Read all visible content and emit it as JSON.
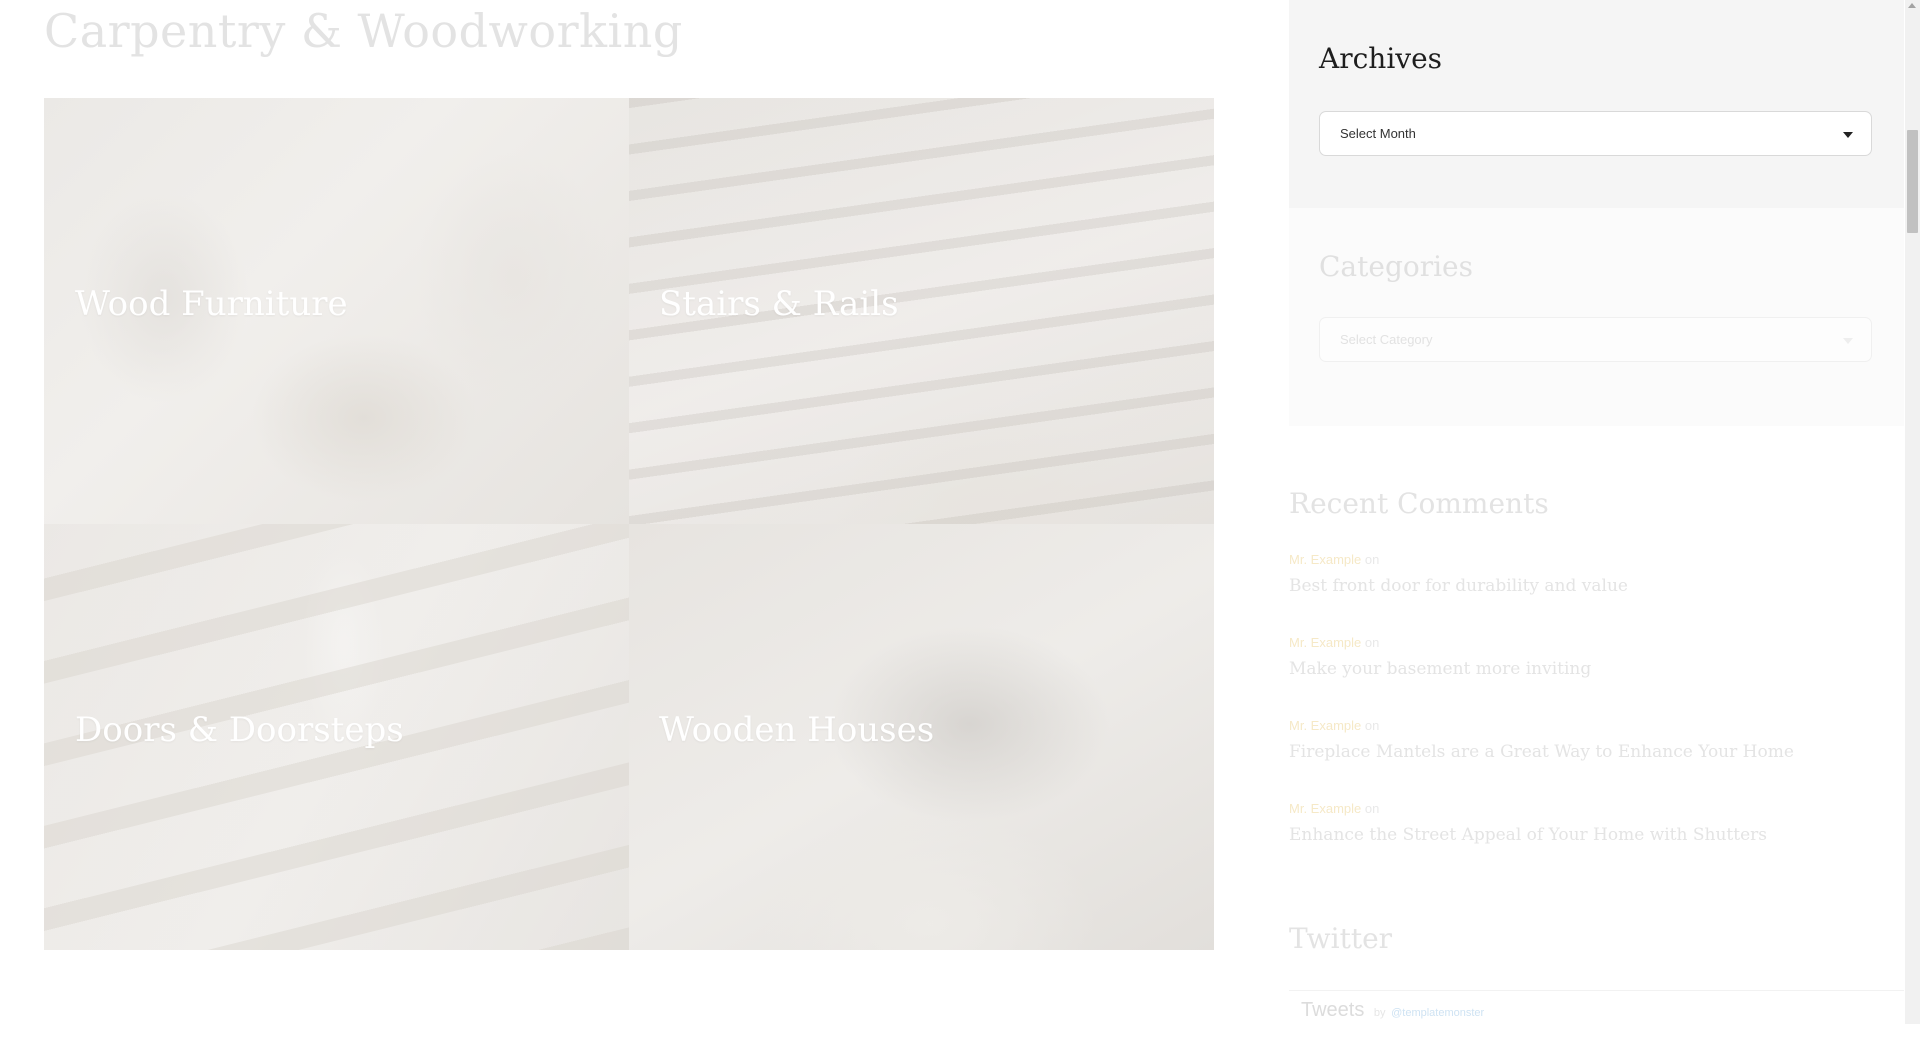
{
  "main": {
    "title": "Carpentry & Woodworking",
    "tiles": [
      {
        "label": "Wood Furniture"
      },
      {
        "label": "Stairs & Rails"
      },
      {
        "label": "Doors & Doorsteps"
      },
      {
        "label": "Wooden Houses"
      }
    ]
  },
  "sidebar": {
    "archives": {
      "title": "Archives",
      "select_value": "Select Month"
    },
    "categories": {
      "title": "Categories",
      "select_value": "Select Category"
    },
    "recent_comments": {
      "title": "Recent Comments",
      "on_text": "on",
      "items": [
        {
          "author": "Mr. Example",
          "post": "Best front door for durability and value"
        },
        {
          "author": "Mr. Example",
          "post": "Make your basement more inviting"
        },
        {
          "author": "Mr. Example",
          "post": "Fireplace Mantels are a Great Way to Enhance Your Home"
        },
        {
          "author": "Mr. Example",
          "post": "Enhance the Street Appeal of Your Home with Shutters"
        }
      ]
    },
    "twitter": {
      "title": "Twitter",
      "tweets_label": "Tweets",
      "by_text": "by",
      "handle": "@templatemonster"
    }
  },
  "colors": {
    "panel_bg": "#f5f5f5",
    "author_link": "#f6e9c7",
    "handle_link": "#cfe3f3"
  }
}
